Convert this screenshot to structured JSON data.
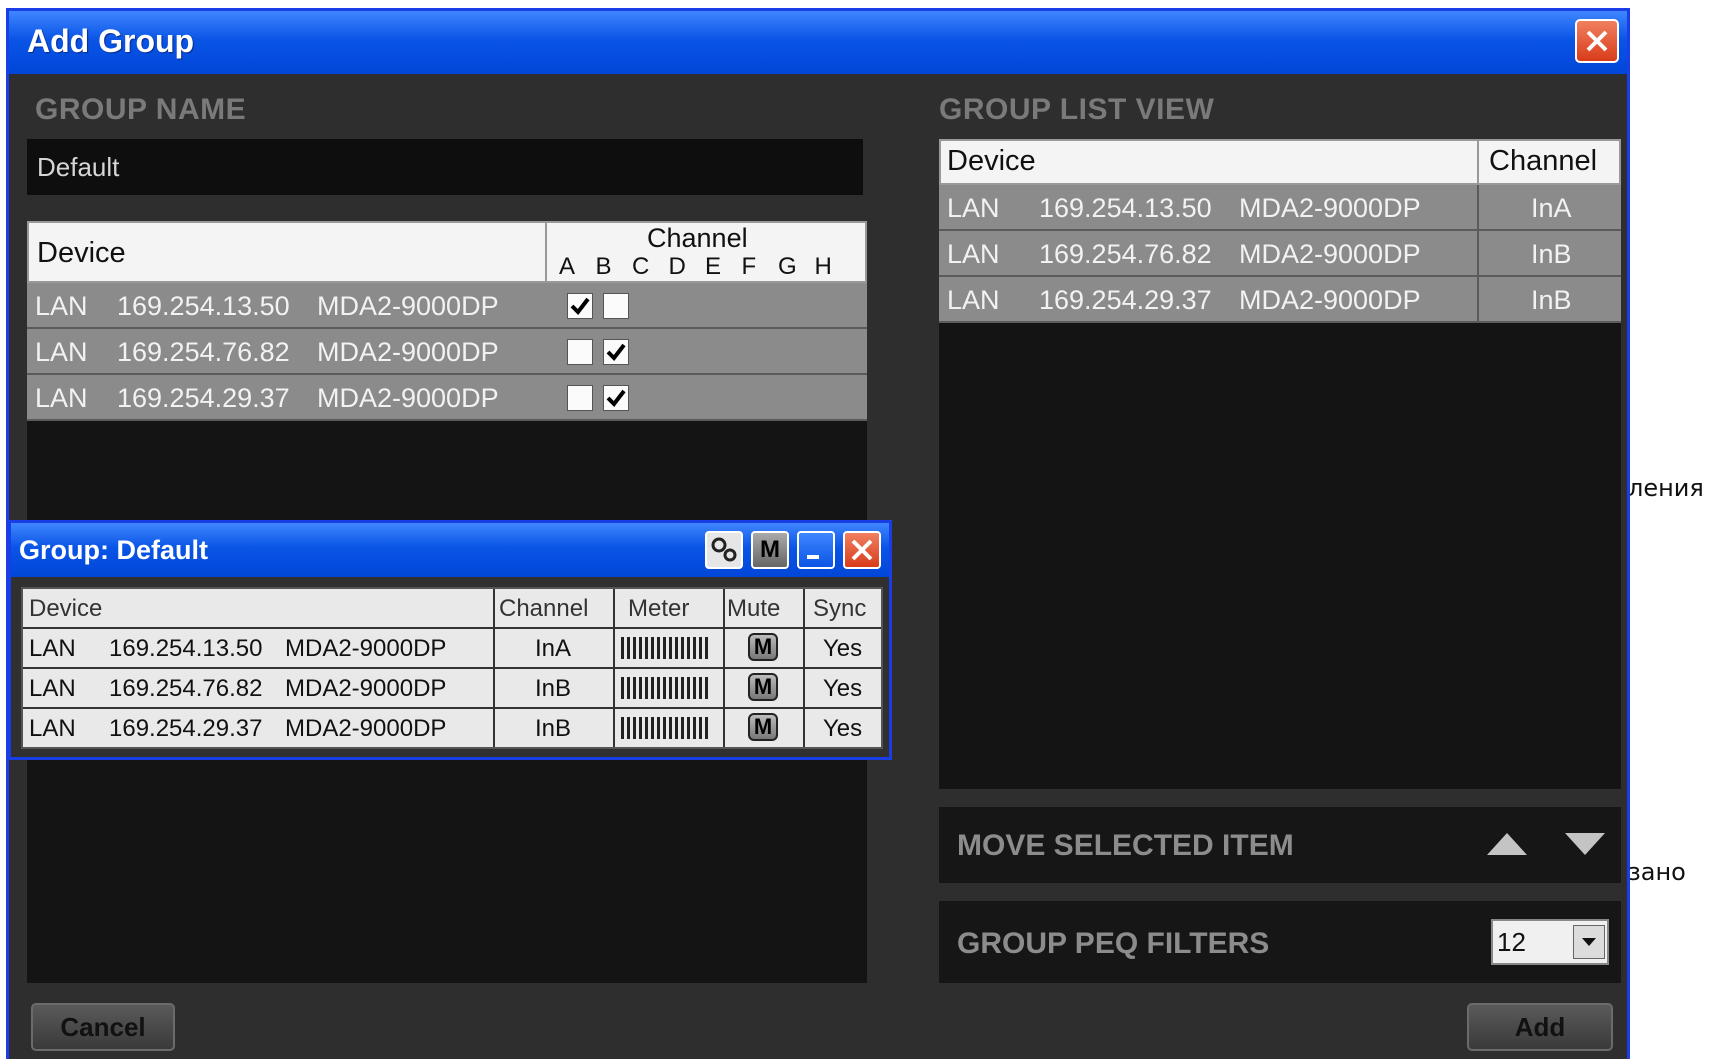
{
  "window": {
    "title": "Add Group"
  },
  "group_name": {
    "label": "GROUP NAME",
    "value": "Default"
  },
  "device_table": {
    "header_device": "Device",
    "header_channel": "Channel",
    "channel_letters": [
      "A",
      "B",
      "C",
      "D",
      "E",
      "F",
      "G",
      "H"
    ],
    "rows": [
      {
        "type": "LAN",
        "ip": "169.254.13.50",
        "model": "MDA2-9000DP",
        "a": true,
        "b": false
      },
      {
        "type": "LAN",
        "ip": "169.254.76.82",
        "model": "MDA2-9000DP",
        "a": false,
        "b": true
      },
      {
        "type": "LAN",
        "ip": "169.254.29.37",
        "model": "MDA2-9000DP",
        "a": false,
        "b": true
      }
    ]
  },
  "group_list_view": {
    "label": "GROUP LIST VIEW",
    "header_device": "Device",
    "header_channel": "Channel",
    "rows": [
      {
        "type": "LAN",
        "ip": "169.254.13.50",
        "model": "MDA2-9000DP",
        "channel": "InA"
      },
      {
        "type": "LAN",
        "ip": "169.254.76.82",
        "model": "MDA2-9000DP",
        "channel": "InB"
      },
      {
        "type": "LAN",
        "ip": "169.254.29.37",
        "model": "MDA2-9000DP",
        "channel": "InB"
      }
    ]
  },
  "move_selected": {
    "label": "MOVE SELECTED ITEM"
  },
  "peq": {
    "label": "GROUP PEQ FILTERS",
    "value": "12"
  },
  "buttons": {
    "cancel": "Cancel",
    "add": "Add"
  },
  "group_window": {
    "title": "Group: Default",
    "m_button": "M",
    "headers": {
      "device": "Device",
      "channel": "Channel",
      "meter": "Meter",
      "mute": "Mute",
      "sync": "Sync"
    },
    "rows": [
      {
        "type": "LAN",
        "ip": "169.254.13.50",
        "model": "MDA2-9000DP",
        "channel": "InA",
        "mute": "M",
        "sync": "Yes"
      },
      {
        "type": "LAN",
        "ip": "169.254.76.82",
        "model": "MDA2-9000DP",
        "channel": "InB",
        "mute": "M",
        "sync": "Yes"
      },
      {
        "type": "LAN",
        "ip": "169.254.29.37",
        "model": "MDA2-9000DP",
        "channel": "InB",
        "mute": "M",
        "sync": "Yes"
      }
    ]
  },
  "background_text": {
    "line1": "ления",
    "line2": "зано"
  },
  "colors": {
    "titlebar": "#0a55e6",
    "window_border": "#1a3ee6",
    "panel_bg": "#2e2e2e",
    "row_bg": "#8b8b8b"
  }
}
